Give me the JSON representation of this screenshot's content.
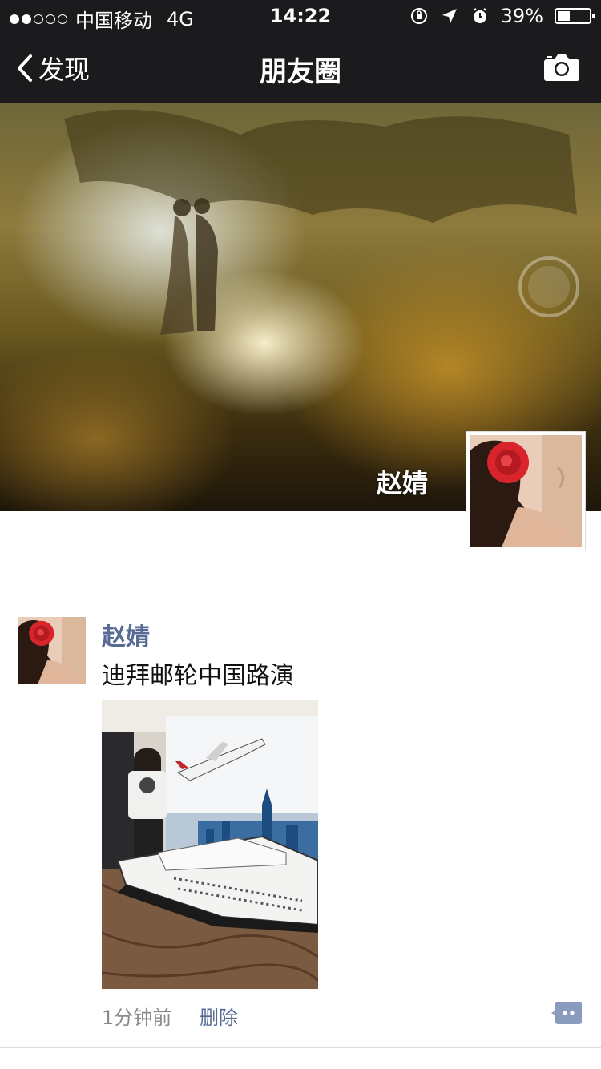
{
  "status_bar": {
    "carrier": "中国移动",
    "network": "4G",
    "time": "14:22",
    "battery": "39%",
    "battery_level": 0.39,
    "signal_bars_filled": 2,
    "signal_bars_total": 5
  },
  "nav": {
    "back_label": "发现",
    "title": "朋友圈",
    "camera_icon": "camera-icon"
  },
  "cover": {
    "user_name": "赵婧"
  },
  "post": {
    "author": "赵婧",
    "text": "迪拜邮轮中国路演",
    "time": "1分钟前",
    "delete_label": "删除",
    "comment_icon": "comment-icon"
  },
  "colors": {
    "bar_bg": "#1b1b1d",
    "link": "#576b95",
    "meta": "#8a8a8a"
  }
}
